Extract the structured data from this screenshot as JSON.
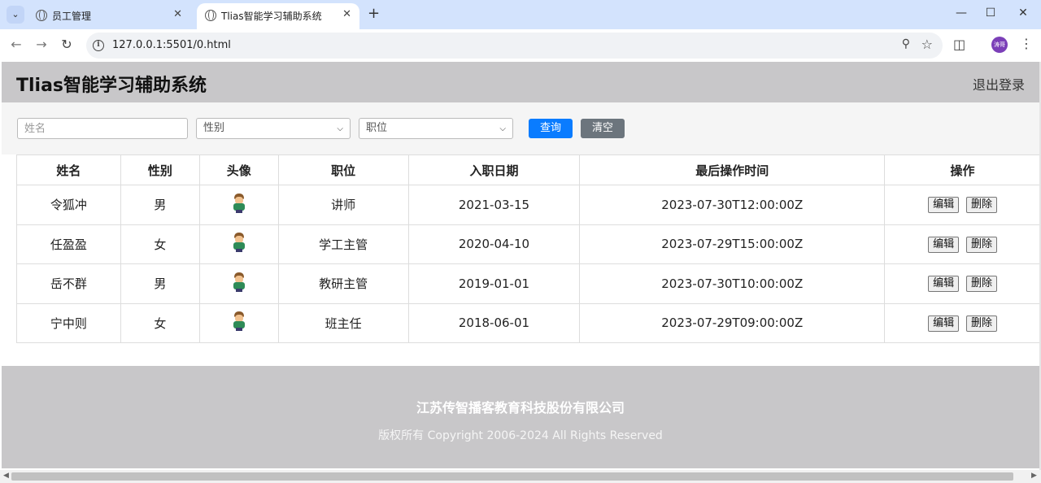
{
  "browser": {
    "tabs": [
      {
        "title": "员工管理"
      },
      {
        "title": "Tlias智能学习辅助系统"
      }
    ],
    "url": "127.0.0.1:5501/0.html",
    "profile_initials": "涛哥"
  },
  "header": {
    "title": "Tlias智能学习辅助系统",
    "logout": "退出登录"
  },
  "search": {
    "name_placeholder": "姓名",
    "gender_select": "性别",
    "position_select": "职位",
    "query_label": "查询",
    "clear_label": "清空"
  },
  "table": {
    "columns": [
      "姓名",
      "性别",
      "头像",
      "职位",
      "入职日期",
      "最后操作时间",
      "操作"
    ],
    "rows": [
      {
        "name": "令狐冲",
        "gender": "男",
        "position": "讲师",
        "entry_date": "2021-03-15",
        "update_time": "2023-07-30T12:00:00Z"
      },
      {
        "name": "任盈盈",
        "gender": "女",
        "position": "学工主管",
        "entry_date": "2020-04-10",
        "update_time": "2023-07-29T15:00:00Z"
      },
      {
        "name": "岳不群",
        "gender": "男",
        "position": "教研主管",
        "entry_date": "2019-01-01",
        "update_time": "2023-07-30T10:00:00Z"
      },
      {
        "name": "宁中则",
        "gender": "女",
        "position": "班主任",
        "entry_date": "2018-06-01",
        "update_time": "2023-07-29T09:00:00Z"
      }
    ],
    "edit_label": "编辑",
    "delete_label": "删除"
  },
  "footer": {
    "company": "江苏传智播客教育科技股份有限公司",
    "copyright": "版权所有 Copyright 2006-2024 All Rights Reserved"
  },
  "colors": {
    "header_bg": "#c8c7c9",
    "query_button": "#0a7cff",
    "clear_button": "#6c757d",
    "tabbar_bg": "#d3e3fd"
  }
}
